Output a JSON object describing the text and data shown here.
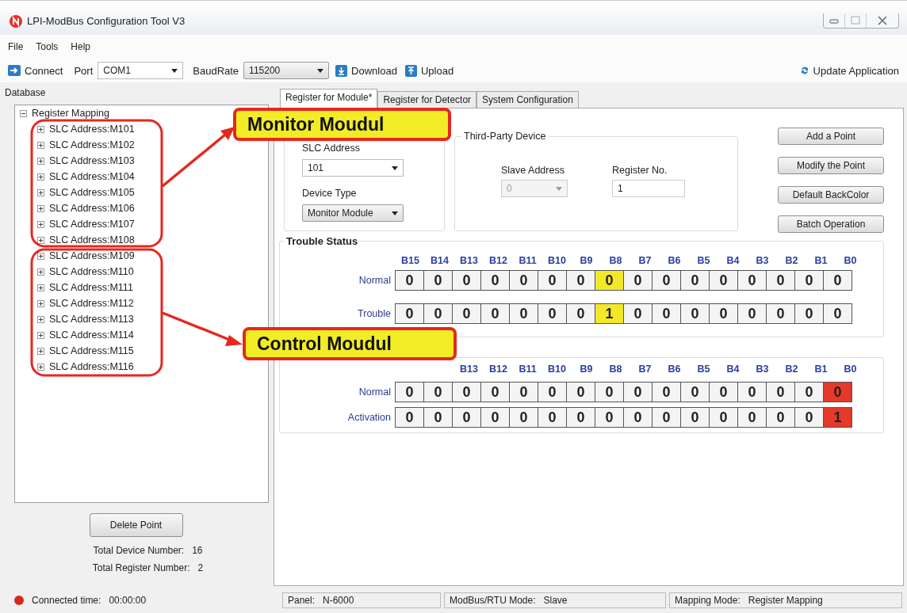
{
  "window": {
    "title": "LPI-ModBus Configuration Tool V3"
  },
  "menu": [
    "File",
    "Tools",
    "Help"
  ],
  "toolbar": {
    "connect": "Connect",
    "port_label": "Port",
    "port": "COM1",
    "baud_label": "BaudRate",
    "baud": "115200",
    "download": "Download",
    "upload": "Upload",
    "update": "Update Application"
  },
  "sidebar": {
    "title": "Database",
    "tree": [
      {
        "label": "Register Mapping",
        "expanded": true,
        "children": [
          {
            "label": "SLC Address:M101",
            "expanded": false
          },
          {
            "label": "SLC Address:M102",
            "expanded": false
          },
          {
            "label": "SLC Address:M103",
            "expanded": false
          },
          {
            "label": "SLC Address:M104",
            "expanded": false
          },
          {
            "label": "SLC Address:M105",
            "expanded": false
          },
          {
            "label": "SLC Address:M106",
            "expanded": false
          },
          {
            "label": "SLC Address:M107",
            "expanded": false
          },
          {
            "label": "SLC Address:M108",
            "expanded": false
          },
          {
            "label": "SLC Address:M109",
            "expanded": false
          },
          {
            "label": "SLC Address:M110",
            "expanded": false
          },
          {
            "label": "SLC Address:M111",
            "expanded": false
          },
          {
            "label": "SLC Address:M112",
            "expanded": false
          },
          {
            "label": "SLC Address:M113",
            "expanded": false
          },
          {
            "label": "SLC Address:M114",
            "expanded": false
          },
          {
            "label": "SLC Address:M115",
            "expanded": false
          },
          {
            "label": "SLC Address:M116",
            "expanded": false
          }
        ]
      }
    ],
    "delete_button": "Delete Point",
    "totals": [
      {
        "label": "Total Device Number:",
        "value": "16"
      },
      {
        "label": "Total Register Number:",
        "value": "2"
      }
    ]
  },
  "tabs": [
    {
      "label": "Register for Module*",
      "selected": true
    },
    {
      "label": "Register for Detector",
      "selected": false
    },
    {
      "label": "System Configuration",
      "selected": false
    }
  ],
  "module": {
    "slc_label": "SLC Address",
    "slc": "101",
    "type_label": "Device Type",
    "type": "Monitor Module"
  },
  "third_party": {
    "title": "Third-Party Device",
    "slave_label": "Slave Address",
    "slave": "0",
    "slave_disabled": true,
    "register_label": "Register No.",
    "register": "1"
  },
  "buttons": [
    "Add a Point",
    "Modify the Point",
    "Default BackColor",
    "Batch Operation"
  ],
  "registers": [
    {
      "title": "Trouble Status",
      "headers": [
        "B15",
        "B14",
        "B13",
        "B12",
        "B11",
        "B10",
        "B9",
        "B8",
        "B7",
        "B6",
        "B5",
        "B4",
        "B3",
        "B2",
        "B1",
        "B0"
      ],
      "rows": [
        {
          "label": "Normal",
          "bits": [
            {
              "value": "0"
            },
            {
              "value": "0"
            },
            {
              "value": "0"
            },
            {
              "value": "0"
            },
            {
              "value": "0"
            },
            {
              "value": "0"
            },
            {
              "value": "0"
            },
            {
              "value": "0",
              "color": "#f2e828"
            },
            {
              "value": "0"
            },
            {
              "value": "0"
            },
            {
              "value": "0"
            },
            {
              "value": "0"
            },
            {
              "value": "0"
            },
            {
              "value": "0"
            },
            {
              "value": "0"
            },
            {
              "value": "0"
            }
          ]
        },
        {
          "label": "Trouble",
          "bits": [
            {
              "value": "0"
            },
            {
              "value": "0"
            },
            {
              "value": "0"
            },
            {
              "value": "0"
            },
            {
              "value": "0"
            },
            {
              "value": "0"
            },
            {
              "value": "0"
            },
            {
              "value": "1",
              "color": "#f2e828"
            },
            {
              "value": "0"
            },
            {
              "value": "0"
            },
            {
              "value": "0"
            },
            {
              "value": "0"
            },
            {
              "value": "0"
            },
            {
              "value": "0"
            },
            {
              "value": "0"
            },
            {
              "value": "0"
            }
          ]
        }
      ]
    },
    {
      "headers": [
        "B13",
        "B12",
        "B11",
        "B10",
        "B9",
        "B8",
        "B7",
        "B6",
        "B5",
        "B4",
        "B3",
        "B2",
        "B1",
        "B0"
      ],
      "rows": [
        {
          "label": "Normal",
          "bits": [
            {
              "value": "0"
            },
            {
              "value": "0"
            },
            {
              "value": "0"
            },
            {
              "value": "0"
            },
            {
              "value": "0"
            },
            {
              "value": "0"
            },
            {
              "value": "0"
            },
            {
              "value": "0"
            },
            {
              "value": "0"
            },
            {
              "value": "0"
            },
            {
              "value": "0"
            },
            {
              "value": "0"
            },
            {
              "value": "0"
            },
            {
              "value": "0"
            },
            {
              "value": "0"
            },
            {
              "value": "0",
              "color": "#e5392b"
            }
          ]
        },
        {
          "label": "Activation",
          "bits": [
            {
              "value": "0"
            },
            {
              "value": "0"
            },
            {
              "value": "0"
            },
            {
              "value": "0"
            },
            {
              "value": "0"
            },
            {
              "value": "0"
            },
            {
              "value": "0"
            },
            {
              "value": "0"
            },
            {
              "value": "0"
            },
            {
              "value": "0"
            },
            {
              "value": "0"
            },
            {
              "value": "0"
            },
            {
              "value": "0"
            },
            {
              "value": "0"
            },
            {
              "value": "0"
            },
            {
              "value": "1",
              "color": "#e5392b"
            }
          ]
        }
      ]
    }
  ],
  "status_bar": [
    {
      "label": "Connected time:",
      "value": "00:00:00",
      "connected": false
    },
    {
      "label": "Panel:",
      "value": "N-6000"
    },
    {
      "label": "ModBus/RTU Mode:",
      "value": "Slave"
    },
    {
      "label": "Mapping Mode:",
      "value": "Register Mapping"
    }
  ],
  "annotations": [
    {
      "label": "Monitor Moudul"
    },
    {
      "label": "Control Moudul"
    }
  ]
}
